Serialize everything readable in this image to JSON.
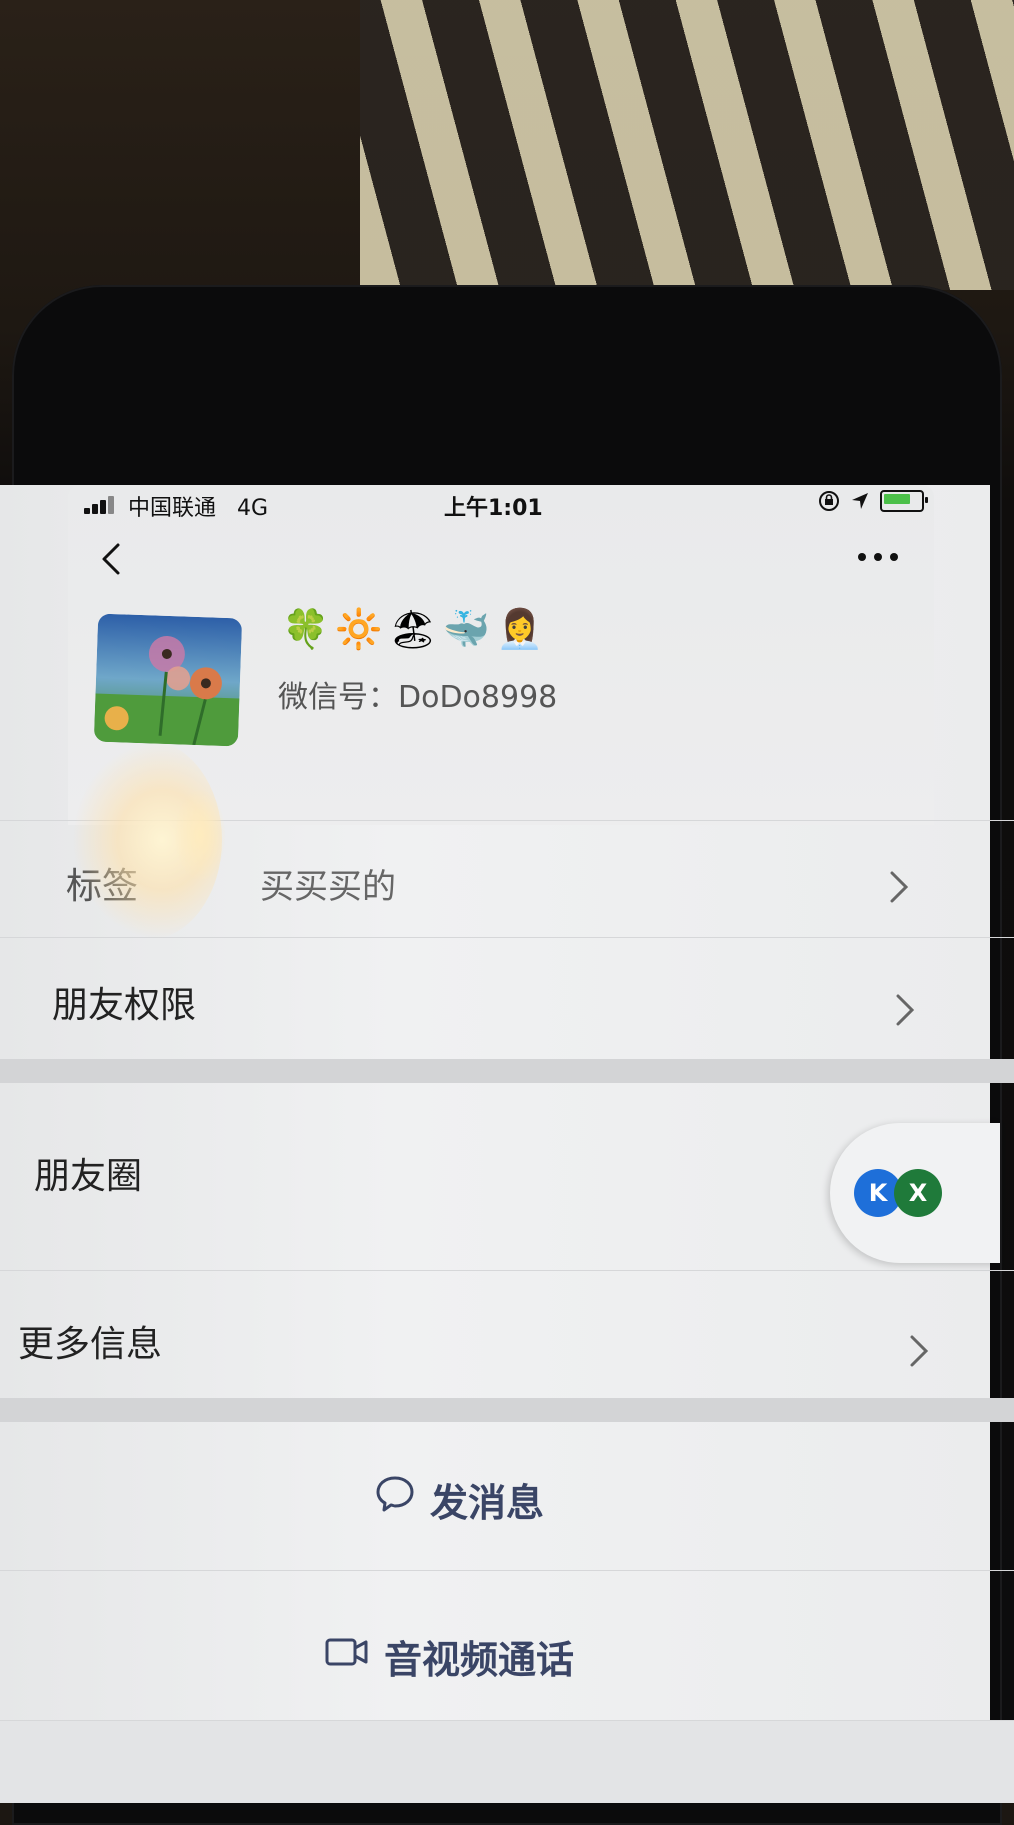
{
  "status_bar": {
    "carrier": "中国联通",
    "network": "4G",
    "time": "上午1:01"
  },
  "profile": {
    "nickname_emojis": "🍀🔆🏖🐳👩‍💼",
    "wechat_id_label": "微信号：",
    "wechat_id": "DoDo8998"
  },
  "rows": {
    "tags_label": "标签",
    "tags_value": "买买买的",
    "friend_permissions_label": "朋友权限",
    "moments_label": "朋友圈",
    "more_info_label": "更多信息"
  },
  "floating_apps": {
    "app1": "K",
    "app2": "X"
  },
  "actions": {
    "send_message": "发消息",
    "video_call": "音视频通话"
  },
  "colors": {
    "accent_text": "#3a4566",
    "battery": "#4cc04a",
    "app1": "#1e6fd9",
    "app2": "#1f7a3a"
  }
}
